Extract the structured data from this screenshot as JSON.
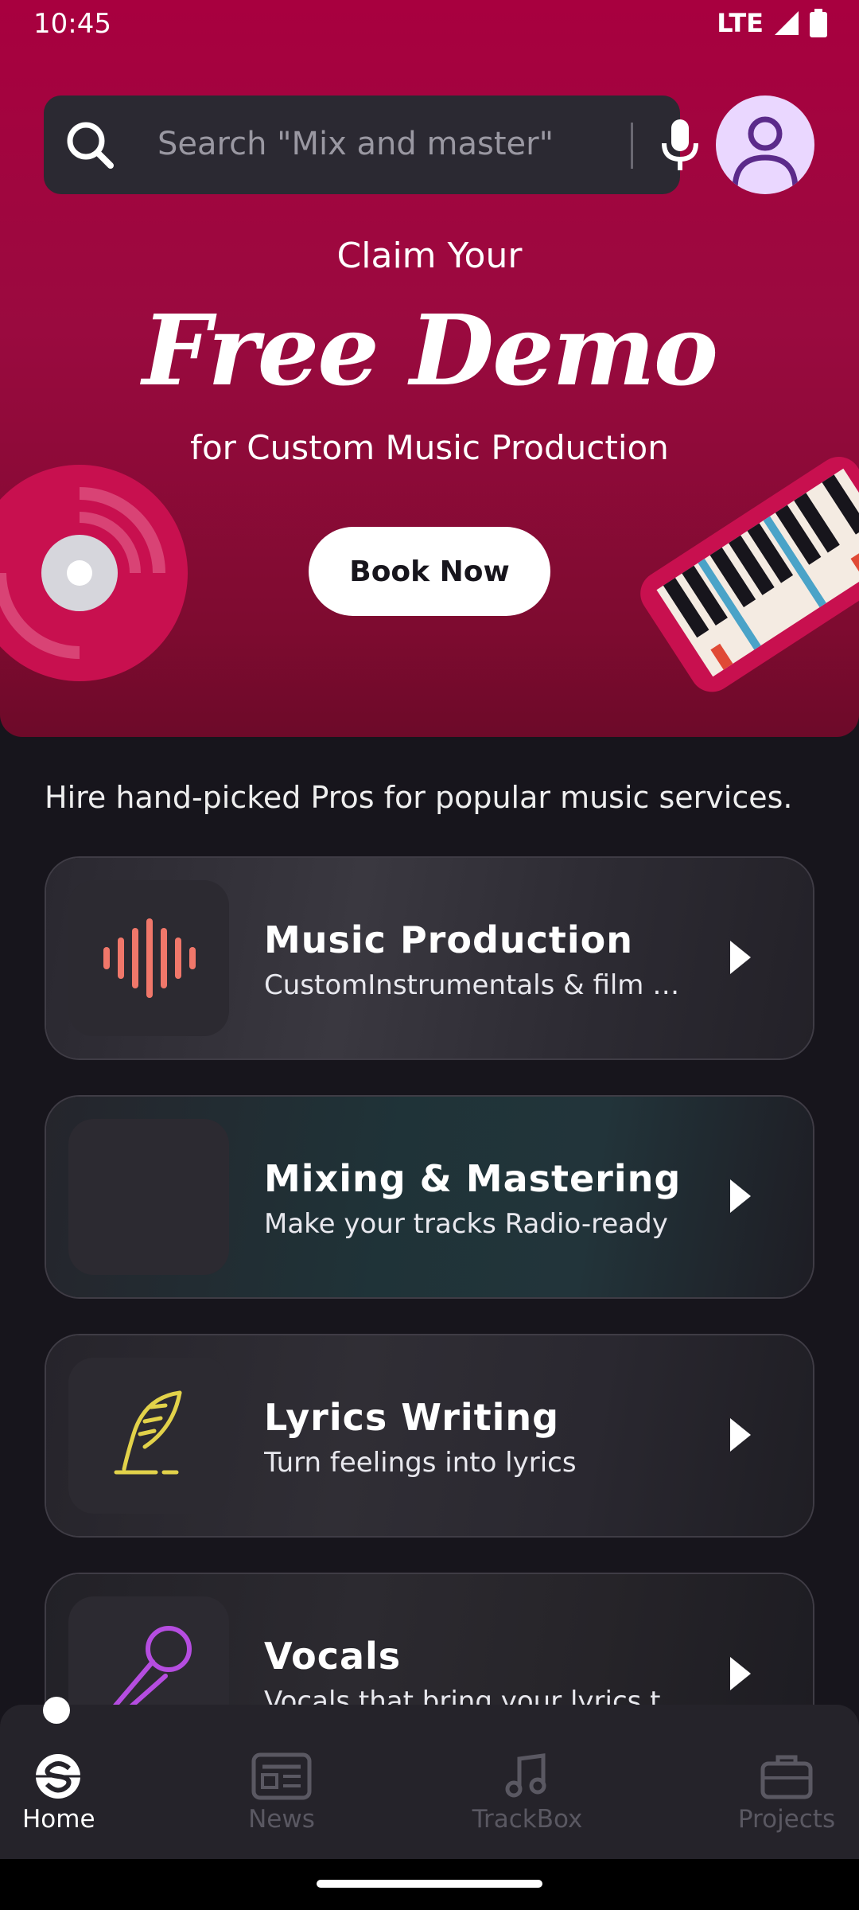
{
  "status_bar": {
    "time": "10:45",
    "network": "LTE"
  },
  "search": {
    "placeholder": "Search \"Mix and master\""
  },
  "hero": {
    "line1": "Claim Your",
    "headline": "Free Demo",
    "line3": "for Custom Music Production",
    "cta": "Book Now"
  },
  "section_intro": "Hire hand-picked Pros for popular music services.",
  "services": [
    {
      "title": "Music Production",
      "subtitle": "CustomInstrumentals & film …"
    },
    {
      "title": "Mixing & Mastering",
      "subtitle": "Make your tracks Radio-ready"
    },
    {
      "title": "Lyrics Writing",
      "subtitle": "Turn feelings into lyrics"
    },
    {
      "title": "Vocals",
      "subtitle": "Vocals that bring your lyrics t..."
    }
  ],
  "nav": [
    {
      "label": "Home",
      "active": true
    },
    {
      "label": "News"
    },
    {
      "label": "TrackBox"
    },
    {
      "label": "Projects"
    }
  ],
  "colors": {
    "accent": "#a8003f",
    "background": "#17151c",
    "card": "#2c2a31"
  }
}
